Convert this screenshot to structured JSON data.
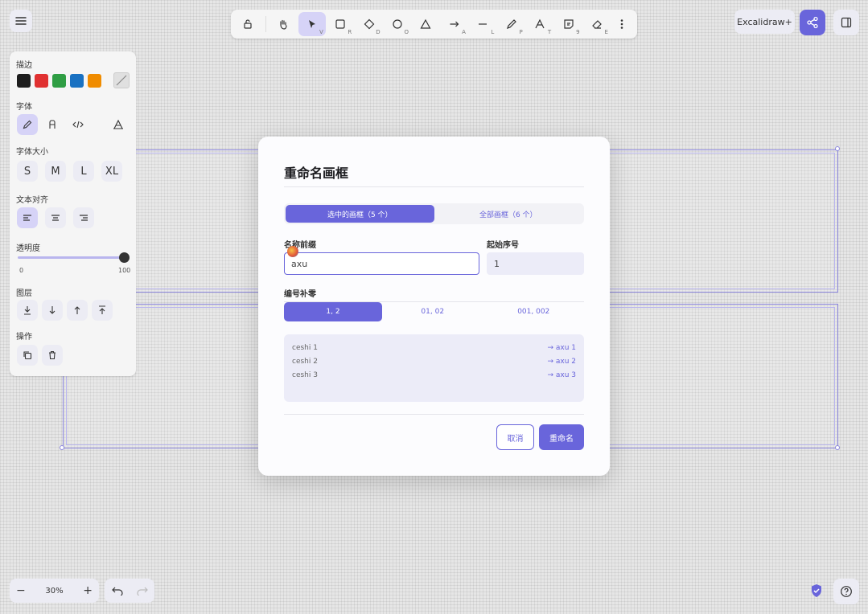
{
  "toolbar": {
    "tools": [
      {
        "name": "lock",
        "key": ""
      },
      {
        "name": "hand",
        "key": ""
      },
      {
        "name": "selection",
        "key": "V"
      },
      {
        "name": "rectangle",
        "key": "R"
      },
      {
        "name": "diamond",
        "key": "D"
      },
      {
        "name": "ellipse",
        "key": "O"
      },
      {
        "name": "arrow",
        "key": "A"
      },
      {
        "name": "line",
        "key": "L"
      },
      {
        "name": "draw",
        "key": "P"
      },
      {
        "name": "text",
        "key": "T"
      },
      {
        "name": "image",
        "key": "9"
      },
      {
        "name": "eraser",
        "key": "E"
      }
    ],
    "active": "selection"
  },
  "header": {
    "library_label": "Excalidraw+"
  },
  "props": {
    "stroke_label": "描边",
    "stroke_colors": [
      "#1e1e1e",
      "#e03131",
      "#2f9e44",
      "#1971c2",
      "#f08c00"
    ],
    "font_label": "字体",
    "font_size_label": "字体大小",
    "sizes": [
      "S",
      "M",
      "L",
      "XL"
    ],
    "align_label": "文本对齐",
    "opacity_label": "透明度",
    "opacity_min": "0",
    "opacity_max": "100",
    "opacity_value": 100,
    "layer_label": "图层",
    "actions_label": "操作"
  },
  "dialog": {
    "title": "重命名画框",
    "scope_options": [
      "选中的画框（5 个）",
      "全部画框（6 个）"
    ],
    "prefix_label": "名称前缀",
    "prefix_value": "axu",
    "start_label": "起始序号",
    "start_value": "1",
    "padding_label": "编号补零",
    "padding_options": [
      "1, 2",
      "01, 02",
      "001, 002"
    ],
    "preview": [
      {
        "from": "ceshi 1",
        "to": "→ axu 1"
      },
      {
        "from": "ceshi 2",
        "to": "→ axu 2"
      },
      {
        "from": "ceshi 3",
        "to": "→ axu 3"
      }
    ],
    "cancel_label": "取消",
    "confirm_label": "重命名"
  },
  "footer": {
    "zoom_minus": "−",
    "zoom_value": "30%",
    "zoom_plus": "+"
  },
  "colors": {
    "accent": "#6965db",
    "accent_light": "#d6d3f7"
  }
}
